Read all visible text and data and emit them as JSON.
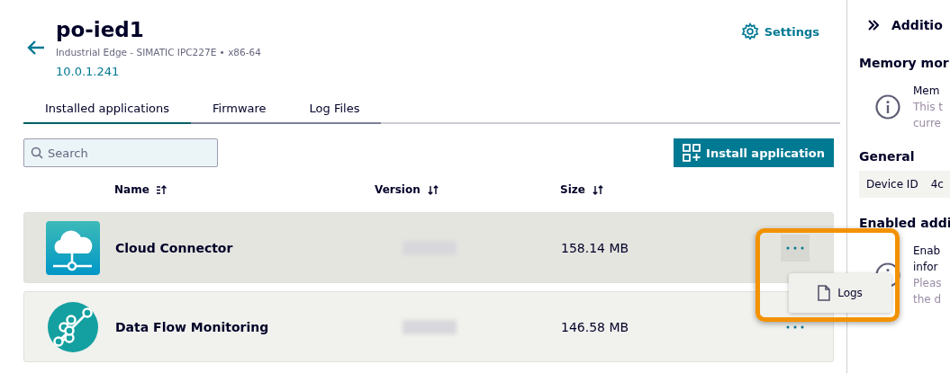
{
  "device": {
    "name": "po-ied1",
    "subtitle": "Industrial Edge - SIMATIC IPC227E • x86-64",
    "address": "10.0.1.241"
  },
  "settings": {
    "label": "Settings"
  },
  "tabs": [
    {
      "label": "Installed applications",
      "selected": true
    },
    {
      "label": "Firmware",
      "selected": false
    },
    {
      "label": "Log Files",
      "selected": false
    }
  ],
  "search": {
    "placeholder": "Search"
  },
  "install_button": {
    "label": "Install application"
  },
  "table": {
    "columns": [
      "Name",
      "Version",
      "Size"
    ],
    "rows": [
      {
        "name": "Cloud Connector",
        "size": "158.14 MB",
        "kind": "cloud",
        "highlighted": true,
        "menu_open": true
      },
      {
        "name": "Data Flow Monitoring",
        "size": "146.58 MB",
        "kind": "flow",
        "highlighted": false,
        "menu_open": false
      }
    ]
  },
  "row_menu": {
    "items": [
      "Logs"
    ]
  },
  "side_panel": {
    "title": "Additio",
    "sections": [
      {
        "heading": "Memory mor",
        "kind": "info",
        "lines": [
          "Mem",
          "This t",
          "curre"
        ]
      },
      {
        "heading": "General",
        "kind": "table",
        "cells": [
          "Device ID",
          "4c"
        ]
      },
      {
        "heading": "Enabled addi",
        "kind": "info",
        "lines": [
          "Enab",
          "infor",
          "Pleas",
          "the d"
        ]
      }
    ]
  }
}
